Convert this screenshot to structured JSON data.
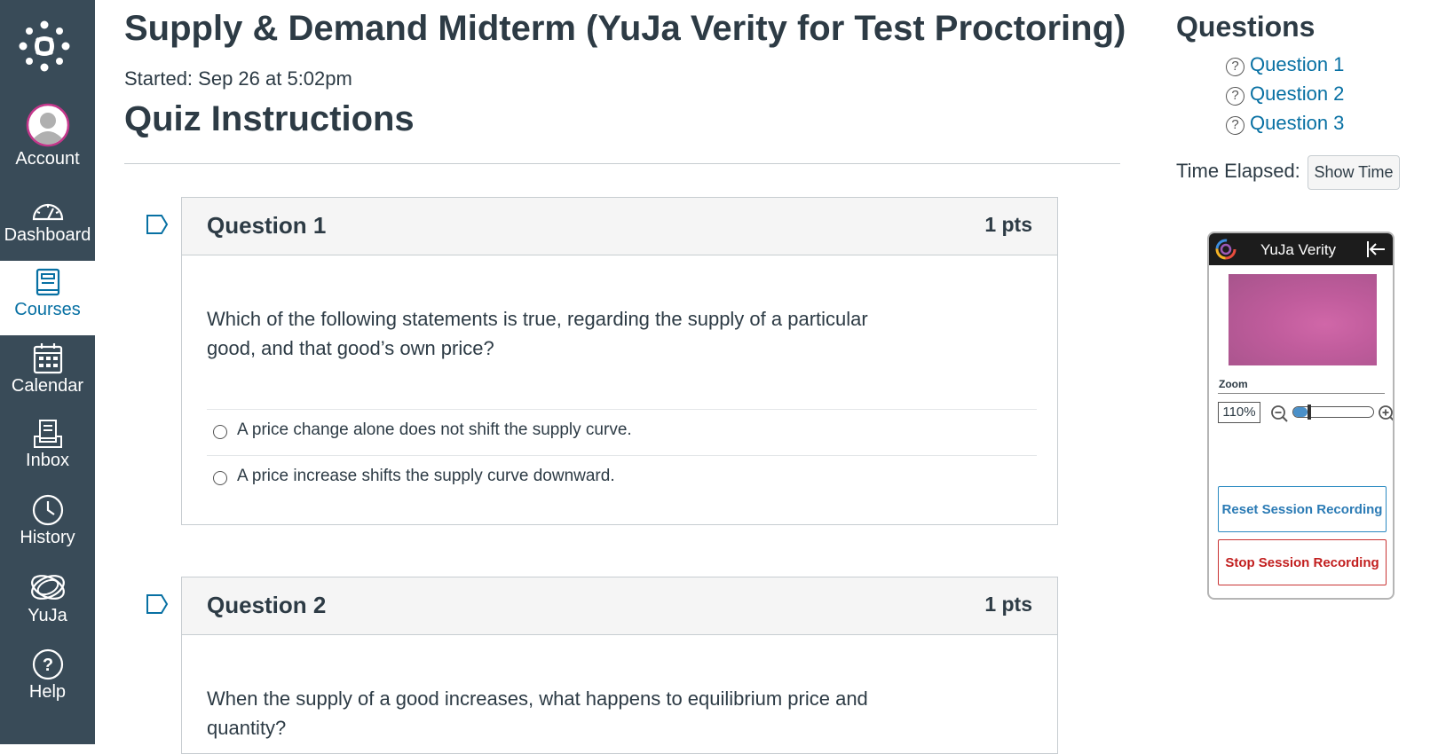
{
  "nav": {
    "items": [
      {
        "key": "account",
        "label": "Account",
        "icon": "account-avatar-icon"
      },
      {
        "key": "dashboard",
        "label": "Dashboard",
        "icon": "dashboard-gauge-icon"
      },
      {
        "key": "courses",
        "label": "Courses",
        "icon": "book-icon",
        "active": true
      },
      {
        "key": "calendar",
        "label": "Calendar",
        "icon": "calendar-icon"
      },
      {
        "key": "inbox",
        "label": "Inbox",
        "icon": "inbox-icon"
      },
      {
        "key": "history",
        "label": "History",
        "icon": "clock-icon"
      },
      {
        "key": "yuja",
        "label": "YuJa",
        "icon": "yuja-rings-icon"
      },
      {
        "key": "help",
        "label": "Help",
        "icon": "help-icon"
      }
    ]
  },
  "quiz": {
    "title": "Supply & Demand Midterm (YuJa Verity for Test Proctoring)",
    "started": "Started: Sep 26 at 5:02pm",
    "instructions_heading": "Quiz Instructions"
  },
  "questions": [
    {
      "name": "Question 1",
      "points": "1 pts",
      "text": "Which of the following statements is true, regarding the supply of a particular good, and that good’s own price?",
      "answers": [
        "A price change alone does not shift the supply curve.",
        "A price increase shifts the supply curve downward."
      ]
    },
    {
      "name": "Question 2",
      "points": "1 pts",
      "text": "When the supply of a good increases, what happens to equilibrium price and quantity?"
    }
  ],
  "sidebar": {
    "heading": "Questions",
    "links": [
      "Question 1",
      "Question 2",
      "Question 3"
    ],
    "time_label": "Time Elapsed:",
    "show_time": "Show Time"
  },
  "yuja": {
    "title": "YuJa Verity",
    "zoom_label": "Zoom",
    "zoom_value": "110%",
    "zoom_fraction": 0.18,
    "reset_label": "Reset Session Recording",
    "stop_label": "Stop Session Recording"
  },
  "colors": {
    "nav_bg": "#394b58",
    "link": "#0770a3",
    "text": "#2d3b45",
    "reset": "#2b7bb5",
    "stop": "#c21f1f"
  }
}
